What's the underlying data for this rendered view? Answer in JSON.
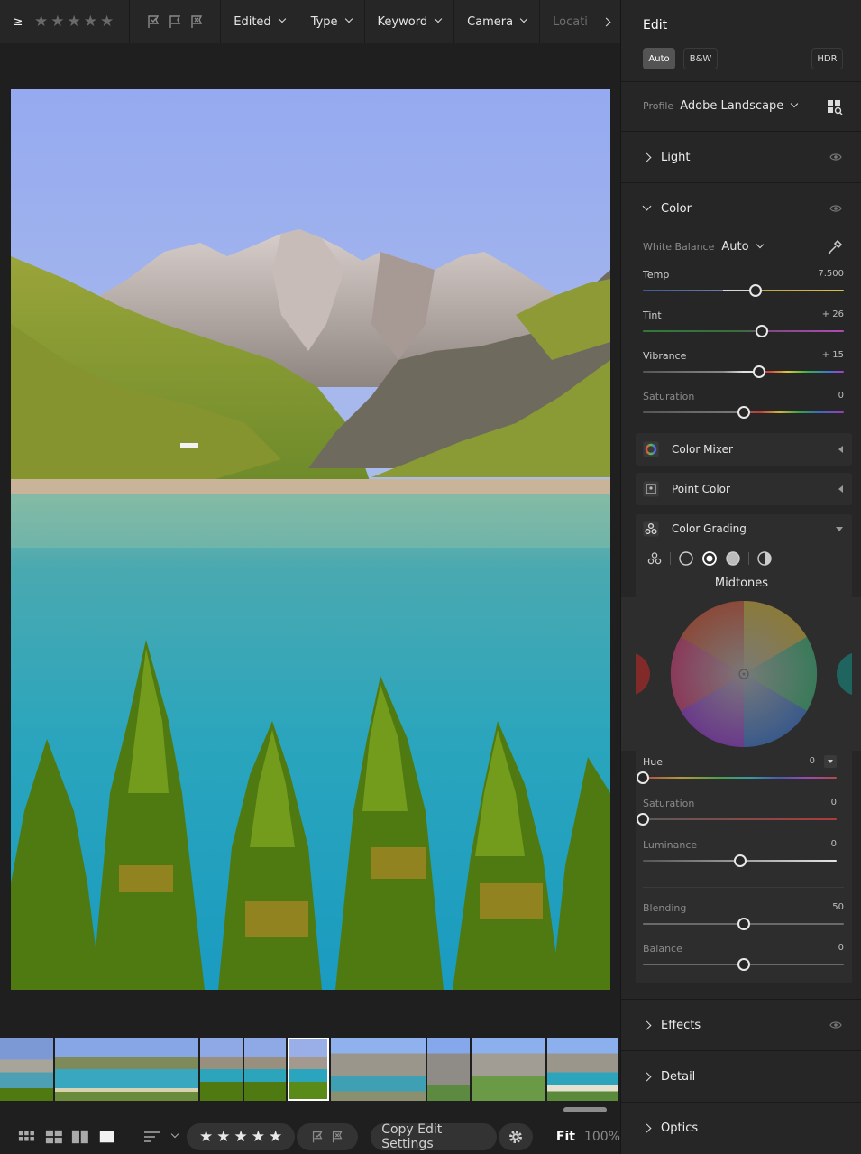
{
  "topbar": {
    "rating_op": "≥",
    "filters": [
      "Edited",
      "Type",
      "Keyword",
      "Camera",
      "Locati"
    ]
  },
  "bottombar": {
    "copy_label": "Copy Edit Settings",
    "fit_label": "Fit",
    "zoom_label": "100%"
  },
  "panel": {
    "title": "Edit",
    "auto_label": "Auto",
    "bw_label": "B&W",
    "hdr_label": "HDR",
    "profile_label": "Profile",
    "profile_value": "Adobe Landscape",
    "sections": {
      "light": "Light",
      "color": "Color",
      "effects": "Effects",
      "detail": "Detail",
      "optics": "Optics"
    },
    "white_balance_label": "White Balance",
    "white_balance_value": "Auto",
    "color_sliders": [
      {
        "label": "Temp",
        "value": "7.500",
        "pos": 0.56
      },
      {
        "label": "Tint",
        "value": "+ 26",
        "pos": 0.59
      },
      {
        "label": "Vibrance",
        "value": "+ 15",
        "pos": 0.58
      },
      {
        "label": "Saturation",
        "value": "0",
        "pos": 0.5
      }
    ],
    "color_mixer": "Color Mixer",
    "point_color": "Point Color",
    "color_grading": "Color Grading",
    "midtones_label": "Midtones",
    "grading_sliders": [
      {
        "label": "Hue",
        "value": "0",
        "pos": 0.0
      },
      {
        "label": "Saturation",
        "value": "0",
        "pos": 0.0
      },
      {
        "label": "Luminance",
        "value": "0",
        "pos": 0.5
      }
    ],
    "blend_sliders": [
      {
        "label": "Blending",
        "value": "50",
        "pos": 0.5
      },
      {
        "label": "Balance",
        "value": "0",
        "pos": 0.5
      }
    ]
  },
  "colors": {
    "bg": "#1f1f1f",
    "panel": "#262626",
    "subpanel": "#2d2d2d",
    "text": "#d6d6d6"
  }
}
